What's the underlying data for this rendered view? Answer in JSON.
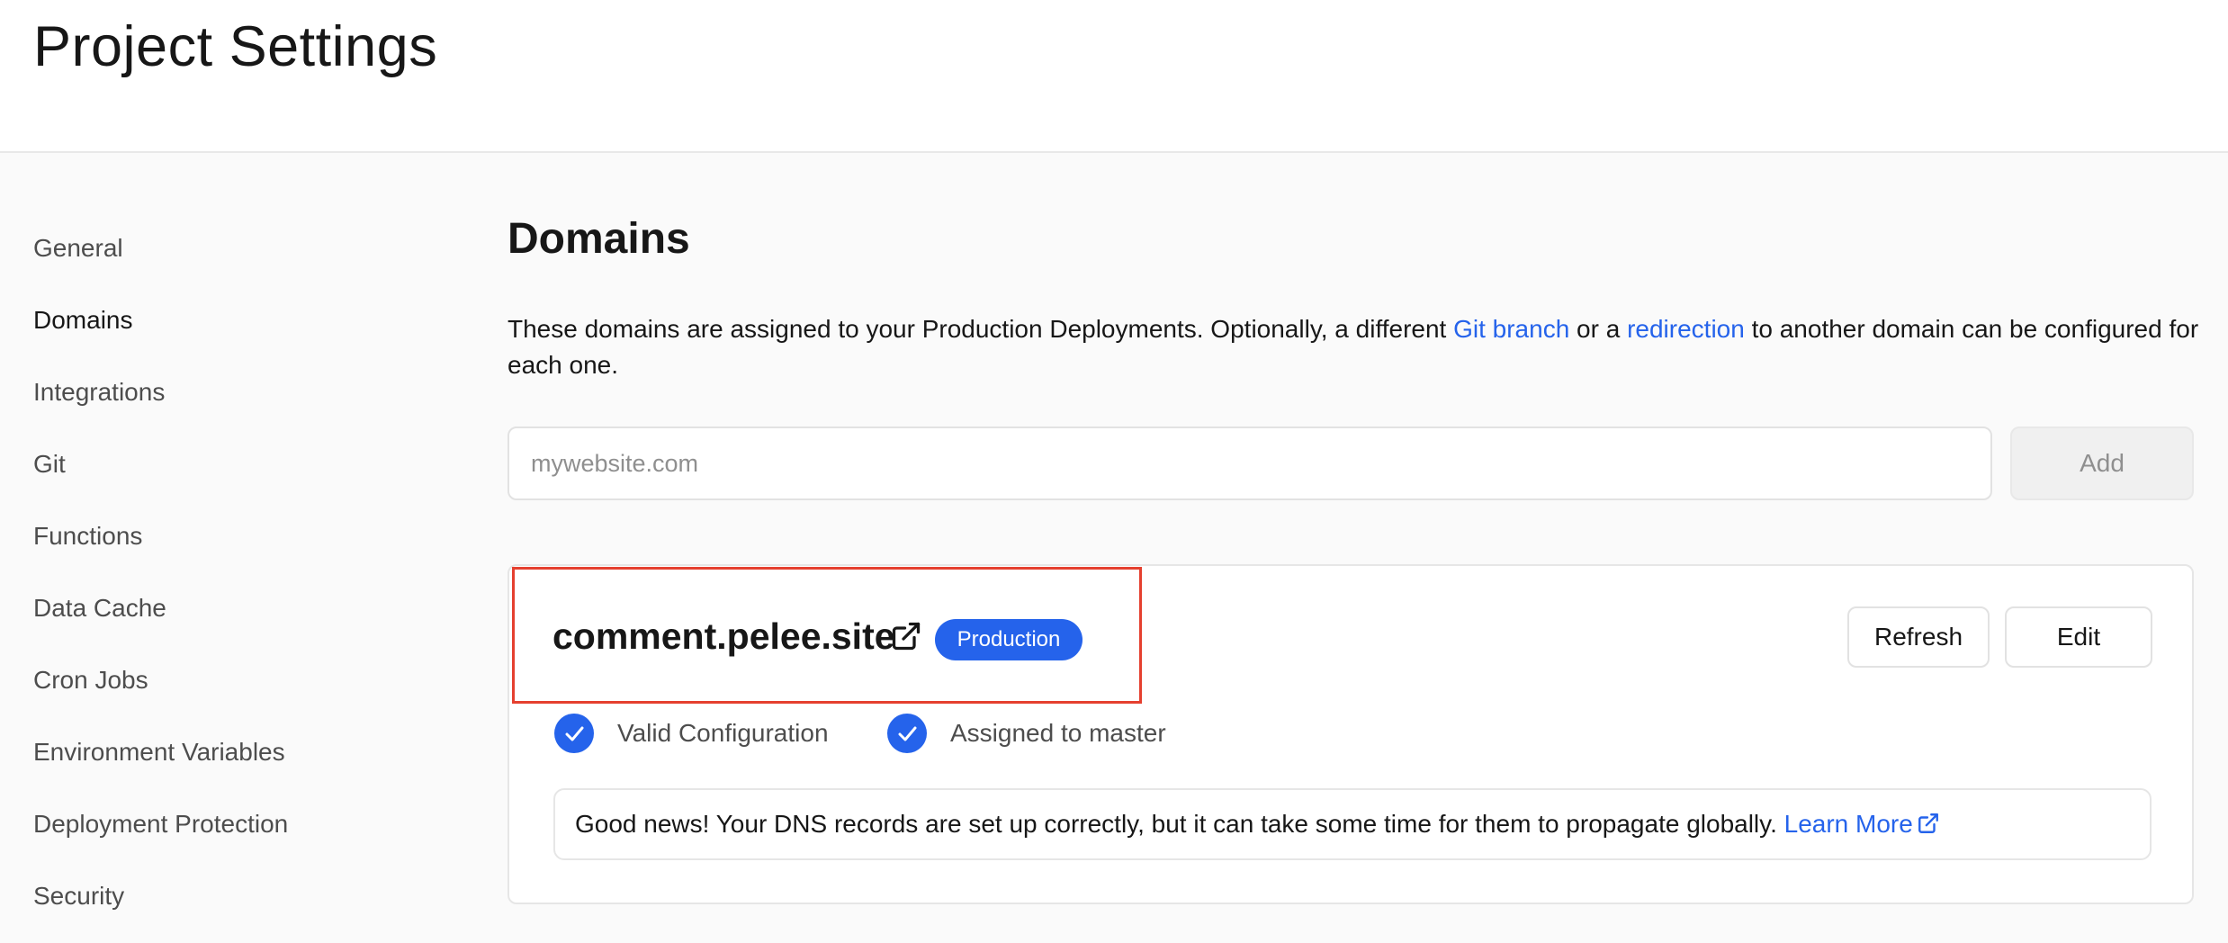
{
  "header": {
    "title": "Project Settings"
  },
  "sidebar": {
    "items": [
      {
        "label": "General",
        "active": false
      },
      {
        "label": "Domains",
        "active": true
      },
      {
        "label": "Integrations",
        "active": false
      },
      {
        "label": "Git",
        "active": false
      },
      {
        "label": "Functions",
        "active": false
      },
      {
        "label": "Data Cache",
        "active": false
      },
      {
        "label": "Cron Jobs",
        "active": false
      },
      {
        "label": "Environment Variables",
        "active": false
      },
      {
        "label": "Deployment Protection",
        "active": false
      },
      {
        "label": "Security",
        "active": false
      }
    ]
  },
  "main": {
    "title": "Domains",
    "description": {
      "text_before": "These domains are assigned to your Production Deployments. Optionally, a different ",
      "link1": "Git branch",
      "text_middle": " or a ",
      "link2": "redirection",
      "text_after": " to another domain can be configured for each one."
    },
    "add_domain": {
      "placeholder": "mywebsite.com",
      "value": "",
      "button_label": "Add"
    },
    "domain_card": {
      "domain": "comment.pelee.site",
      "badge": "Production",
      "refresh_label": "Refresh",
      "edit_label": "Edit",
      "status_items": [
        {
          "label": "Valid Configuration",
          "icon": "check-circle-icon"
        },
        {
          "label": "Assigned to master",
          "icon": "check-circle-icon"
        }
      ],
      "notice": {
        "text": "Good news! Your DNS records are set up correctly, but it can take some time for them to propagate globally. ",
        "link": "Learn More"
      }
    }
  },
  "colors": {
    "accent": "#2563eb",
    "highlight_box": "#e5402f",
    "background": "#fafafa",
    "surface": "#ffffff"
  }
}
